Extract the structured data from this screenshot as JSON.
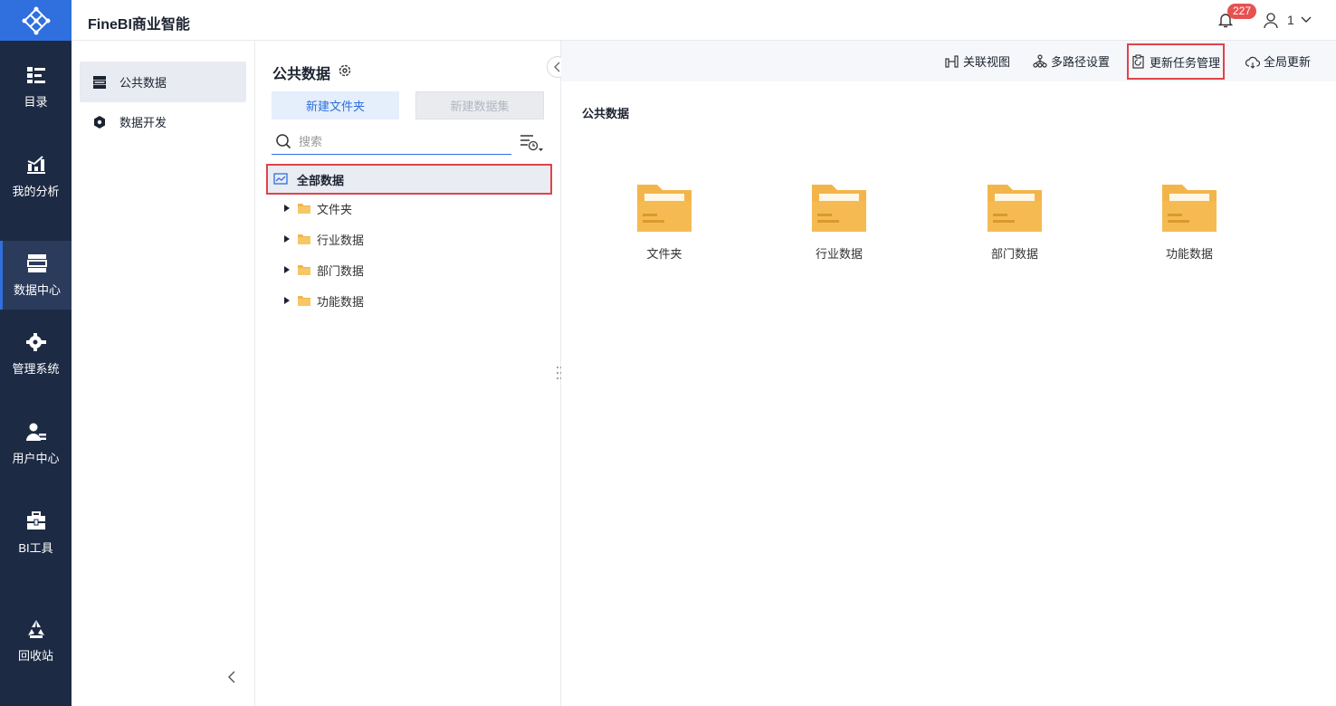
{
  "app": {
    "title": "FineBI商业智能"
  },
  "header": {
    "notification_count": "227",
    "user_name": "1"
  },
  "leftnav": {
    "items": [
      {
        "label": "目录",
        "icon": "catalog-icon"
      },
      {
        "label": "我的分析",
        "icon": "analysis-icon"
      },
      {
        "label": "数据中心",
        "icon": "data-center-icon",
        "active": true
      },
      {
        "label": "管理系统",
        "icon": "settings-gear-icon"
      },
      {
        "label": "用户中心",
        "icon": "user-center-icon"
      },
      {
        "label": "BI工具",
        "icon": "toolbox-icon"
      },
      {
        "label": "回收站",
        "icon": "recycle-icon"
      }
    ]
  },
  "subnav": {
    "items": [
      {
        "label": "公共数据",
        "icon": "public-data-icon",
        "active": true
      },
      {
        "label": "数据开发",
        "icon": "data-dev-icon"
      }
    ]
  },
  "tree": {
    "title": "公共数据",
    "new_folder_label": "新建文件夹",
    "new_dataset_label": "新建数据集",
    "search_placeholder": "搜索",
    "root_label": "全部数据",
    "nodes": [
      "文件夹",
      "行业数据",
      "部门数据",
      "功能数据"
    ]
  },
  "toolbar": {
    "relation_view": "关联视图",
    "multi_path": "多路径设置",
    "update_task": "更新任务管理",
    "global_update": "全局更新"
  },
  "main": {
    "title": "公共数据",
    "folders": [
      "文件夹",
      "行业数据",
      "部门数据",
      "功能数据"
    ]
  },
  "colors": {
    "accent": "#2f6fde",
    "nav_bg": "#1d2a44",
    "highlight": "#e0434a",
    "folder": "#f3b54a"
  }
}
